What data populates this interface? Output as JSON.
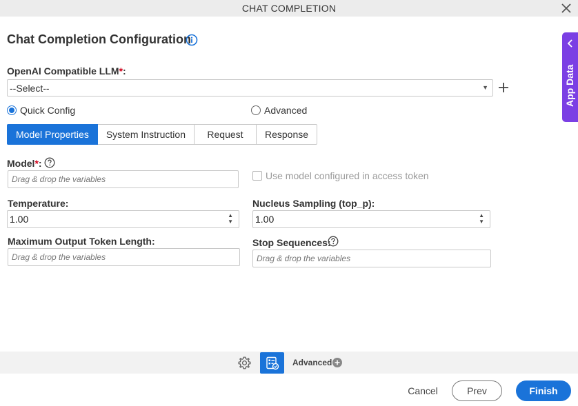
{
  "window": {
    "title": "CHAT COMPLETION"
  },
  "page": {
    "heading": "Chat Completion Configuration"
  },
  "llm": {
    "label": "OpenAI Compatible LLM",
    "required_mark": "*",
    "colon": ":",
    "selected": "--Select--"
  },
  "config_mode": {
    "quick_label": "Quick Config",
    "advanced_label": "Advanced",
    "selected": "Quick Config"
  },
  "tabs": [
    {
      "label": "Model Properties",
      "active": true
    },
    {
      "label": "System Instruction",
      "active": false
    },
    {
      "label": "Request",
      "active": false
    },
    {
      "label": "Response",
      "active": false
    }
  ],
  "model": {
    "label": "Model",
    "required_mark": "*",
    "colon": ":",
    "placeholder": "Drag & drop the variables"
  },
  "use_model_token": {
    "label": "Use model configured in access token",
    "checked": false
  },
  "temperature": {
    "label": "Temperature:",
    "value": "1.00"
  },
  "top_p": {
    "label": "Nucleus Sampling (top_p):",
    "value": "1.00"
  },
  "max_tokens": {
    "label": "Maximum Output Token Length:",
    "placeholder": "Drag & drop the variables"
  },
  "stop_sequences": {
    "label": "Stop Sequences:",
    "placeholder": "Drag & drop the variables"
  },
  "side_panel": {
    "label": "App Data"
  },
  "toolbar": {
    "advanced_label": "Advanced"
  },
  "footer": {
    "cancel": "Cancel",
    "prev": "Prev",
    "finish": "Finish"
  },
  "colors": {
    "primary": "#1a73d9",
    "side_panel": "#7b3fe4",
    "required": "#d0021b"
  },
  "icons": [
    "close-icon",
    "info-icon",
    "plus-icon",
    "help-icon",
    "chevron-left-icon",
    "gear-icon",
    "app-data-icon",
    "plus-circle-icon",
    "spinner-arrows-icon",
    "dropdown-caret-icon"
  ]
}
